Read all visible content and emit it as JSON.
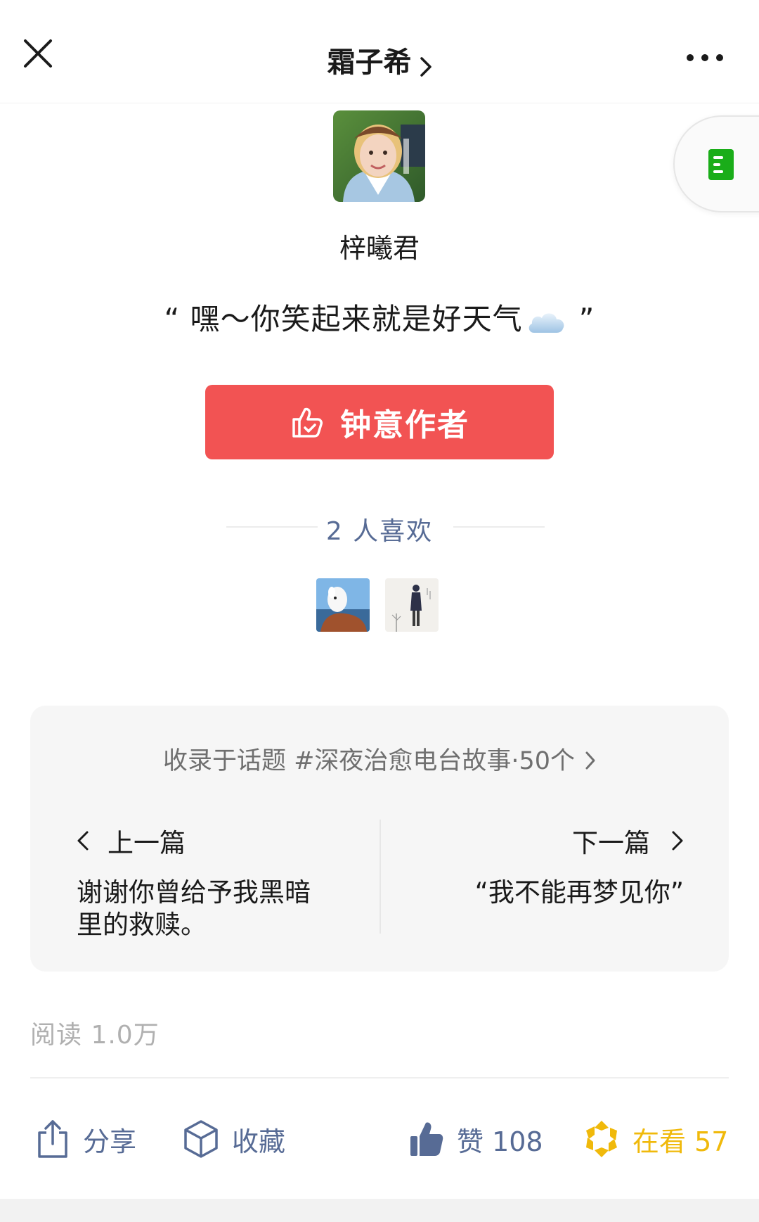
{
  "header": {
    "title": "霜子希",
    "icons": {
      "close": "close-icon",
      "chevron": "chevron-right-icon",
      "more": "more-dots-icon"
    }
  },
  "float_tab": {
    "icon": "document-icon",
    "accent": "#1aad19"
  },
  "author": {
    "name": "梓曦君",
    "quote_open": "“ 嘿～你笑起来就是好天气",
    "quote_close": "”",
    "quote_icon": "cloud-icon"
  },
  "like_author_button": {
    "label": "钟意作者",
    "icon": "thumbs-up-check-icon",
    "color": "#f25353"
  },
  "likers": {
    "count_text": "2 人喜欢"
  },
  "topic": {
    "text": "收录于话题 #深夜治愈电台故事·50个",
    "prev": {
      "label": "上一篇",
      "title": "谢谢你曾给予我黑暗里的救赎。"
    },
    "next": {
      "label": "下一篇",
      "title": "“我不能再梦见你”"
    }
  },
  "stats": {
    "read_text": "阅读 1.0万"
  },
  "actions": {
    "share": "分享",
    "favorite": "收藏",
    "like": "赞 108",
    "watching": "在看 57"
  },
  "colors": {
    "link_blue": "#576b95",
    "watching_gold": "#f0b90b"
  }
}
